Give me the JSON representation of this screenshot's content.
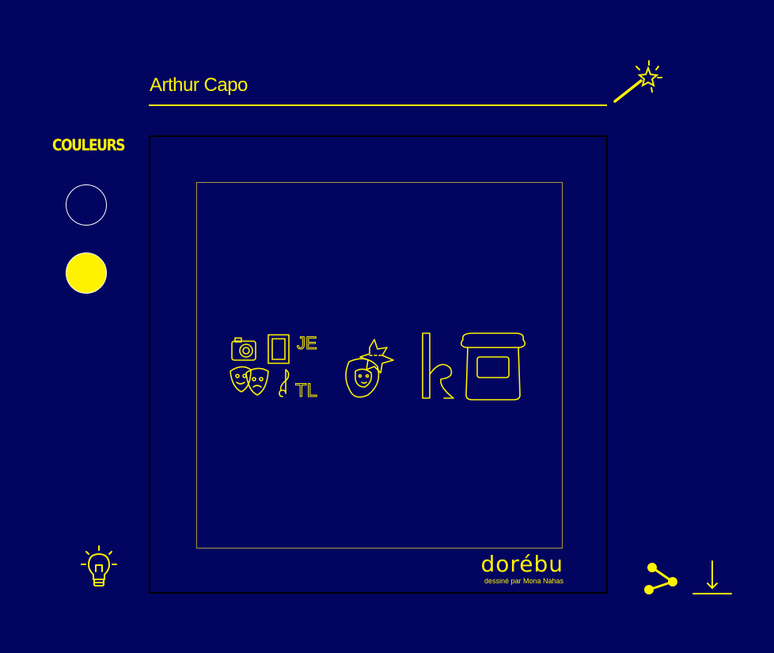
{
  "name_field": {
    "value": "Arthur Capo",
    "placeholder": ""
  },
  "colors_panel": {
    "title": "COULEURS",
    "swatches": [
      {
        "name": "navy-white-outline",
        "fill": "#02055f",
        "stroke": "#ffffff"
      },
      {
        "name": "yellow",
        "fill": "#fff200",
        "stroke": "#ffffff"
      }
    ]
  },
  "canvas": {
    "rebus_glyphs": [
      "JE",
      "TL"
    ],
    "brand": "dorébu",
    "brand_sub": "dessiné par Mona Nahas"
  },
  "icons": {
    "magic_wand": "magic-wand-icon",
    "hint": "lightbulb-icon",
    "share": "share-icon",
    "download": "download-icon"
  },
  "colors": {
    "background": "#02055f",
    "accent": "#fff200",
    "frame": "#a79a3a"
  }
}
